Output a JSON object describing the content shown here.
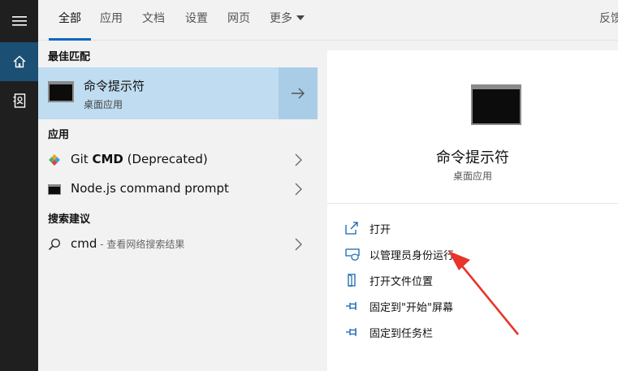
{
  "tabs": [
    {
      "label": "全部",
      "active": true
    },
    {
      "label": "应用",
      "active": false
    },
    {
      "label": "文档",
      "active": false
    },
    {
      "label": "设置",
      "active": false
    },
    {
      "label": "网页",
      "active": false
    },
    {
      "label": "更多",
      "active": false
    }
  ],
  "feedback_label": "反馈",
  "sections": {
    "best_match": "最佳匹配",
    "apps": "应用",
    "search_suggestions": "搜索建议"
  },
  "best_match": {
    "title": "命令提示符",
    "subtitle": "桌面应用"
  },
  "apps": [
    {
      "name_plain": "Git ",
      "name_bold": "CMD",
      "name_tail": " (Deprecated)",
      "icon": "git-icon"
    },
    {
      "name_plain": "Node.js command prompt",
      "name_bold": "",
      "name_tail": "",
      "icon": "console-icon"
    }
  ],
  "suggestion": {
    "query": "cmd",
    "hint": " - 查看网络搜索结果"
  },
  "preview": {
    "title": "命令提示符",
    "subtitle": "桌面应用",
    "actions": [
      {
        "label": "打开",
        "icon": "open-icon"
      },
      {
        "label": "以管理员身份运行",
        "icon": "admin-shield-icon"
      },
      {
        "label": "打开文件位置",
        "icon": "file-location-icon"
      },
      {
        "label": "固定到\"开始\"屏幕",
        "icon": "pin-icon"
      },
      {
        "label": "固定到任务栏",
        "icon": "pin-icon"
      }
    ]
  },
  "colors": {
    "accent": "#0a66c2",
    "selection": "#bfdcf0",
    "rail": "#1f1f1f",
    "annotation_arrow": "#e8352b"
  }
}
